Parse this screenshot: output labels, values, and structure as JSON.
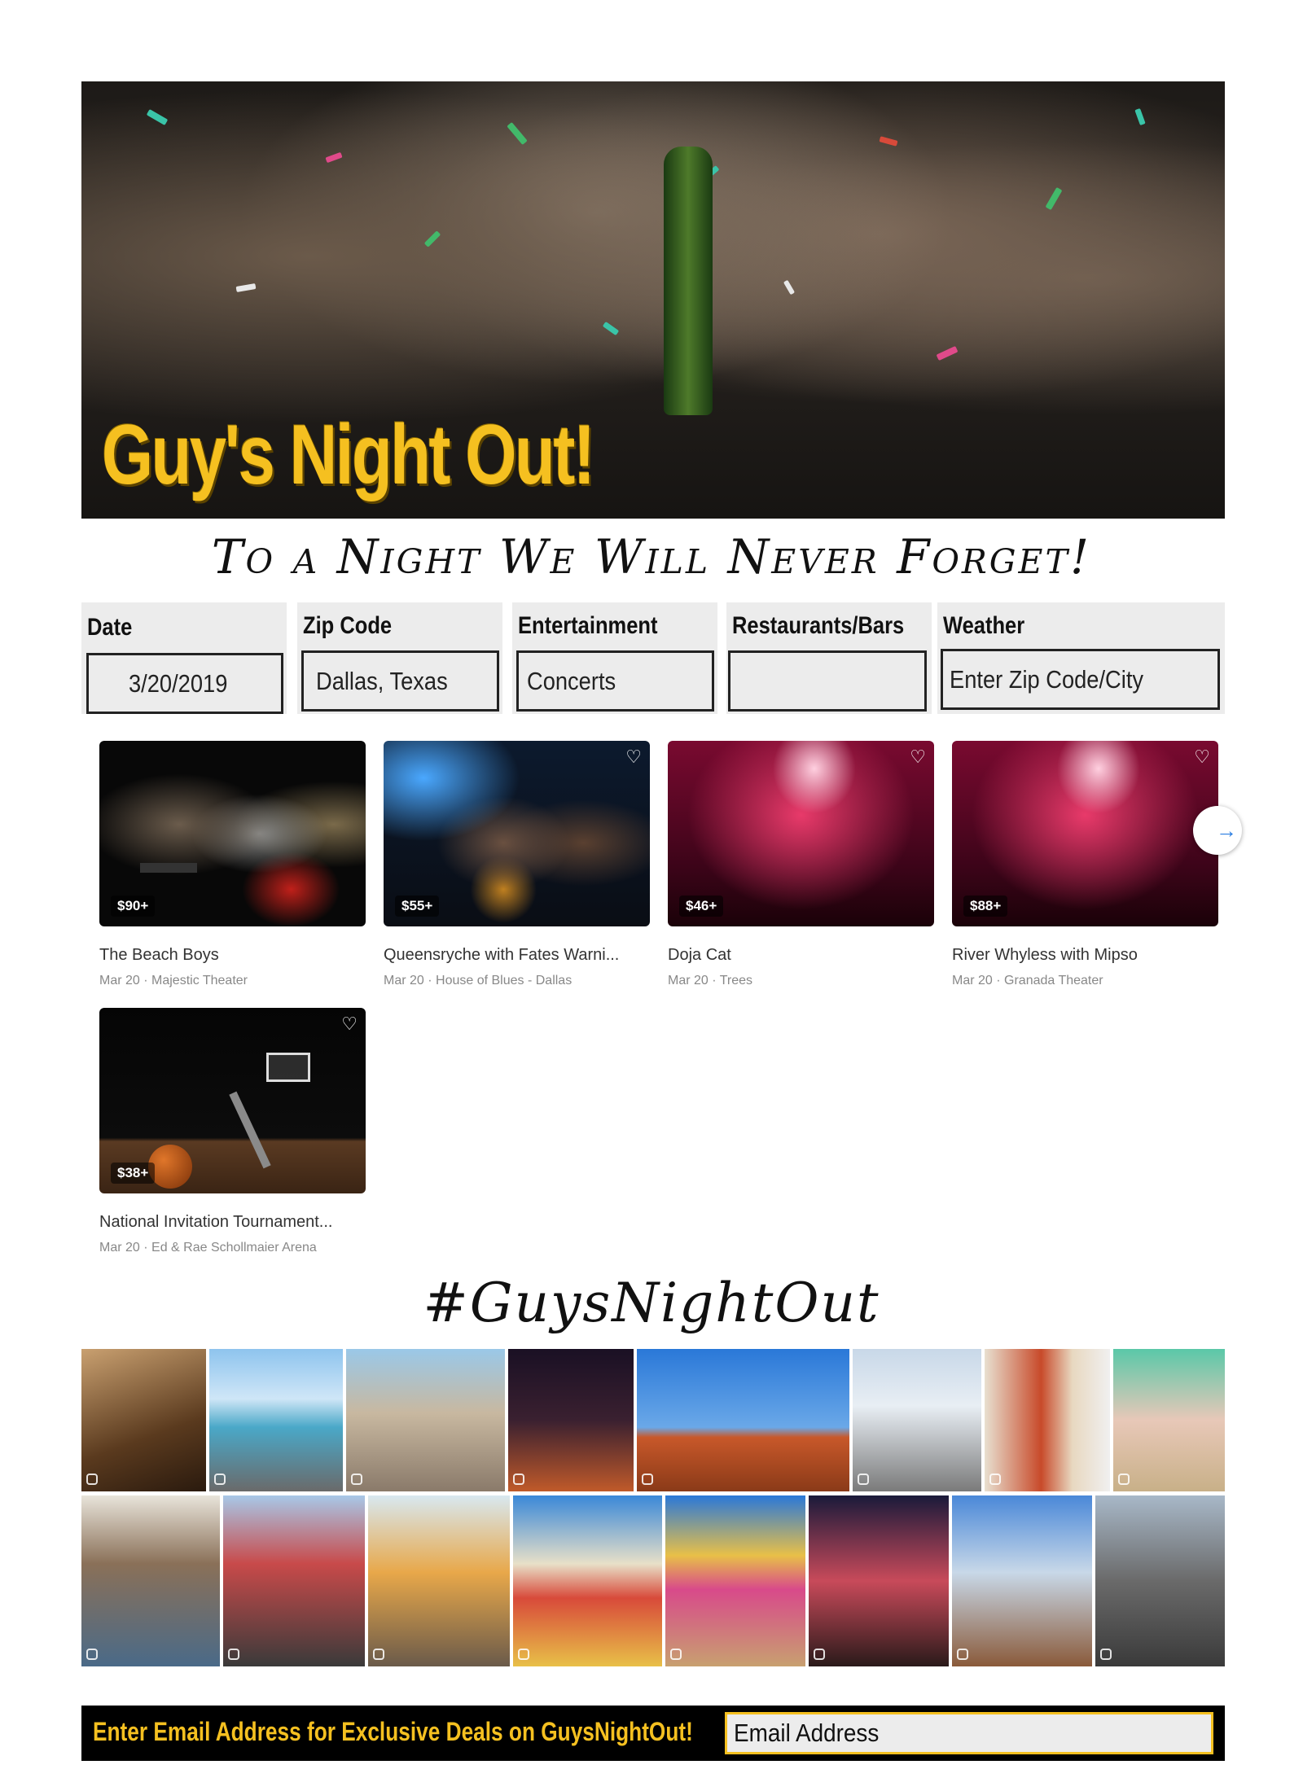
{
  "hero": {
    "title": "Guy's Night Out!",
    "tagline": "To a Night We Will Never Forget!"
  },
  "filters": [
    {
      "label": "Date",
      "value": "3/20/2019"
    },
    {
      "label": "Zip Code",
      "value": "Dallas, Texas"
    },
    {
      "label": "Entertainment",
      "value": "Concerts"
    },
    {
      "label": "Restaurants/Bars",
      "value": ""
    },
    {
      "label": "Weather",
      "value": "Enter Zip Code/City"
    }
  ],
  "events": [
    {
      "price": "$90+",
      "name": "The Beach Boys",
      "meta": "Mar 20 · Majestic Theater"
    },
    {
      "price": "$55+",
      "name": "Queensryche with Fates Warni...",
      "meta": "Mar 20 · House of Blues - Dallas"
    },
    {
      "price": "$46+",
      "name": "Doja Cat",
      "meta": "Mar 20 · Trees"
    },
    {
      "price": "$88+",
      "name": "River Whyless with Mipso",
      "meta": "Mar 20 · Granada Theater"
    },
    {
      "price": "$38+",
      "name": "National Invitation Tournament...",
      "meta": "Mar 20 · Ed & Rae Schollmaier Arena"
    }
  ],
  "icons": {
    "heart": "heart-icon",
    "next": "arrow-right-icon",
    "instagram": "instagram-icon"
  },
  "hashtag": "#GuysNightOut",
  "email": {
    "prompt": "Enter Email Address for Exclusive Deals on GuysNightOut!",
    "placeholder": "Email Address"
  },
  "colors": {
    "accent": "#f5c020",
    "panel": "#ececec",
    "bar": "#000000"
  }
}
